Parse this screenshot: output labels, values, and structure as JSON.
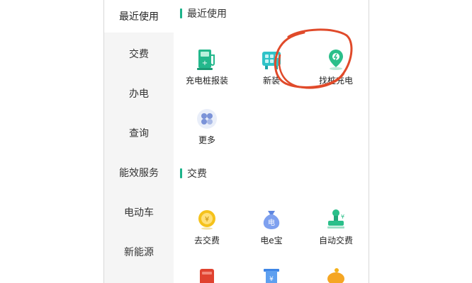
{
  "sidebar": {
    "items": [
      {
        "label": "最近使用",
        "active": true
      },
      {
        "label": "交费"
      },
      {
        "label": "办电"
      },
      {
        "label": "查询"
      },
      {
        "label": "能效服务"
      },
      {
        "label": "电动车"
      },
      {
        "label": "新能源"
      }
    ]
  },
  "sections": {
    "recent": {
      "title": "最近使用",
      "items": [
        {
          "label": "充电桩报装",
          "icon": "charging-pile-icon"
        },
        {
          "label": "新装",
          "icon": "meter-install-icon"
        },
        {
          "label": "找桩充电",
          "icon": "location-charge-icon"
        },
        {
          "label": "更多",
          "icon": "more-grid-icon"
        }
      ]
    },
    "payment": {
      "title": "交费",
      "items": [
        {
          "label": "去交费",
          "icon": "coin-icon"
        },
        {
          "label": "电e宝",
          "icon": "money-bag-icon"
        },
        {
          "label": "自动交费",
          "icon": "stamp-icon"
        }
      ]
    }
  },
  "colors": {
    "accent": "#1cb38a",
    "annotation": "#e04a2a"
  }
}
